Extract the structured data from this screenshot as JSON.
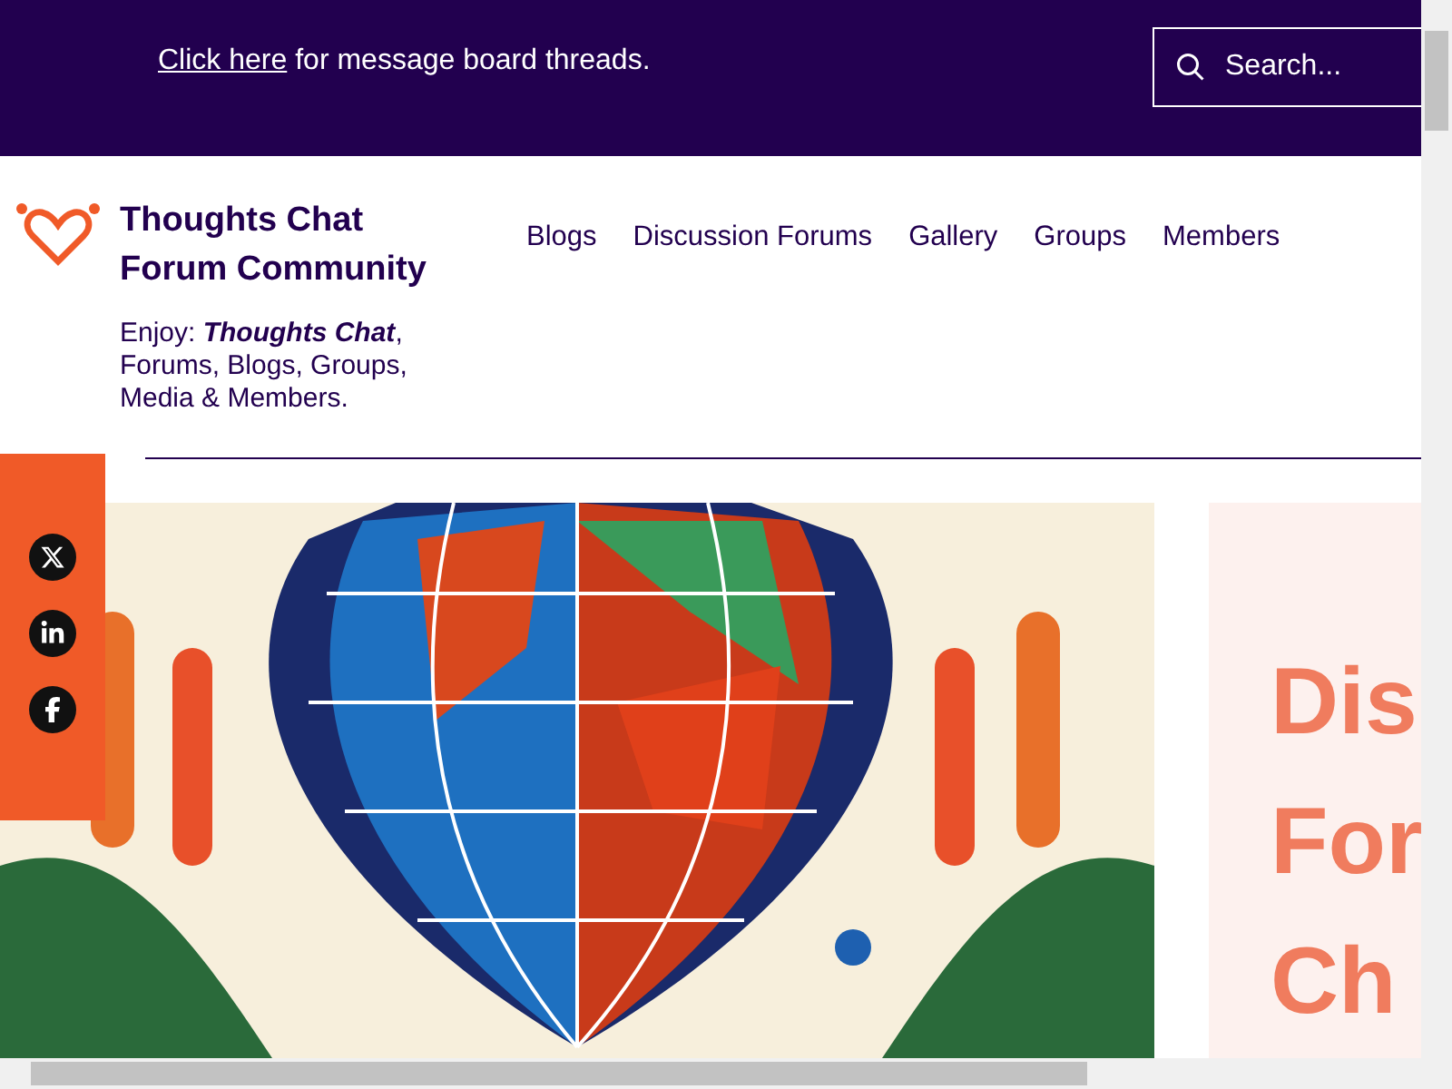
{
  "banner": {
    "link": "Click here",
    "text": "for message board threads."
  },
  "search": {
    "placeholder": "Search..."
  },
  "site": {
    "title_lines": [
      "Thoughts Chat",
      "Forum Community"
    ],
    "tagline": "Enjoy: **Thoughts Chat**, Forums, Blogs, Groups, Media & Members."
  },
  "nav": [
    {
      "label": "Blogs"
    },
    {
      "label": "Discussion Forums"
    },
    {
      "label": "Gallery"
    },
    {
      "label": "Groups"
    },
    {
      "label": "Members"
    }
  ],
  "social": [
    {
      "kind": "x"
    },
    {
      "kind": "linkedin"
    },
    {
      "kind": "facebook"
    }
  ],
  "hero": {
    "heading_lines": [
      "Dis",
      "For",
      "Ch"
    ]
  }
}
